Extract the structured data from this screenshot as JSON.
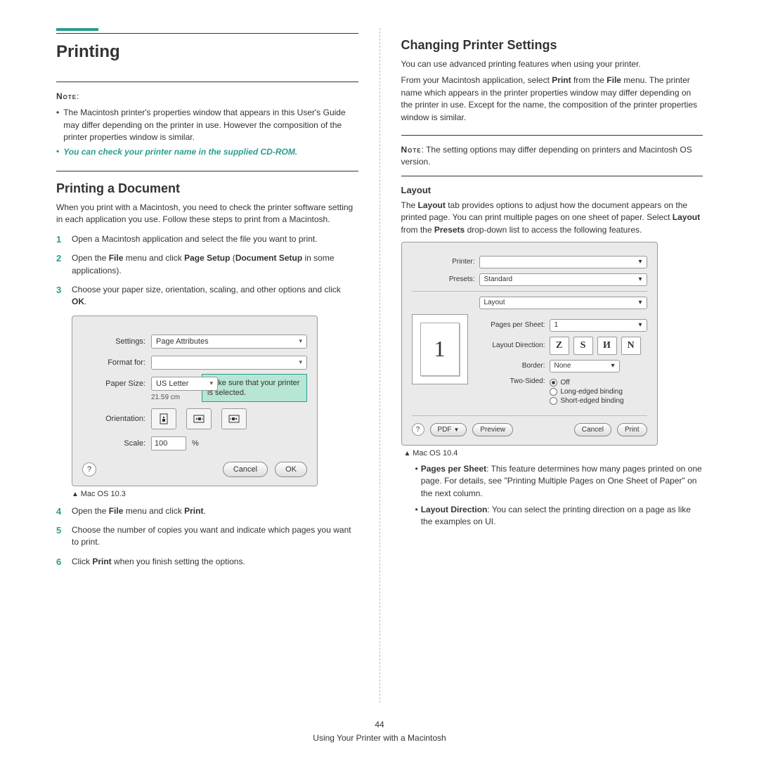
{
  "left": {
    "h1": "Printing",
    "noteLabel": "Note",
    "noteColon": ":",
    "noteBullet1": "The Macintosh printer's properties window that appears in this User's Guide may differ depending on the printer in use. However the composition of the printer properties window is similar.",
    "noteBullet2": "You can check your printer name in the supplied CD-ROM.",
    "h2": "Printing a Document",
    "intro": "When you print with a Macintosh, you need to check the printer software setting in each application you use. Follow these steps to print from a Macintosh.",
    "step1": "Open a Macintosh application and select the file you want to print.",
    "step2a": "Open the ",
    "step2b": "File",
    "step2c": " menu and click ",
    "step2d": "Page Setup",
    "step2e": " (",
    "step2f": "Document Setup",
    "step2g": " in some applications).",
    "step3a": "Choose your paper size, orientation, scaling, and other options and click ",
    "step3b": "OK",
    "step3c": ".",
    "dlg1": {
      "settingsLabel": "Settings:",
      "settingsValue": "Page Attributes",
      "formatLabel": "Format for:",
      "paperLabel": "Paper Size:",
      "paperValue": "US Letter",
      "paperDim": "21.59 cm",
      "orientLabel": "Orientation:",
      "scaleLabel": "Scale:",
      "scaleValue": "100",
      "scalePct": "%",
      "cancel": "Cancel",
      "ok": "OK",
      "help": "?",
      "callout": "Make sure that your printer is selected."
    },
    "caption1": "Mac OS 10.3",
    "step4a": "Open the ",
    "step4b": "File",
    "step4c": " menu and click ",
    "step4d": "Print",
    "step4e": ".",
    "step5": "Choose the number of copies you want and indicate which pages you want to print.",
    "step6a": "Click ",
    "step6b": "Print",
    "step6c": " when you finish setting the options."
  },
  "right": {
    "h2": "Changing Printer Settings",
    "p1": "You can use advanced printing features when using your printer.",
    "p2a": "From your Macintosh application, select ",
    "p2b": "Print",
    "p2c": " from the ",
    "p2d": "File",
    "p2e": " menu. The printer name which appears in the printer properties window may differ depending on the printer in use. Except for the name, the composition of the printer properties window is similar.",
    "noteLabel": "Note",
    "noteText": ": The setting options may differ depending on printers and Macintosh OS version.",
    "h3": "Layout",
    "layoutP_a": "The ",
    "layoutP_b": "Layout",
    "layoutP_c": " tab provides options to adjust how the document appears on the printed page. You can print multiple pages on one sheet of paper. Select ",
    "layoutP_d": "Layout",
    "layoutP_e": " from the ",
    "layoutP_f": "Presets",
    "layoutP_g": " drop-down list to access the following features.",
    "dlg2": {
      "printerLabel": "Printer:",
      "presetsLabel": "Presets:",
      "presetsValue": "Standard",
      "sectionValue": "Layout",
      "ppsLabel": "Pages per Sheet:",
      "ppsValue": "1",
      "ldLabel": "Layout Direction:",
      "borderLabel": "Border:",
      "borderValue": "None",
      "twoSidedLabel": "Two-Sided:",
      "off": "Off",
      "longEdge": "Long-edged binding",
      "shortEdge": "Short-edged binding",
      "pdf": "PDF",
      "preview": "Preview",
      "previewNum": "1",
      "cancel": "Cancel",
      "print": "Print",
      "help": "?",
      "dirZ": "Z",
      "dirS": "S",
      "dirU": "И",
      "dirN": "N"
    },
    "caption2": "Mac OS 10.4",
    "b1a": "Pages per Sheet",
    "b1b": ": This feature determines how many pages printed on one page. For details, see \"Printing Multiple Pages on One Sheet of Paper\" on the next column.",
    "b2a": "Layout Direction",
    "b2b": ": You can select the printing direction on a page as like the examples on UI."
  },
  "footer": {
    "pageNum": "44",
    "title": "Using Your Printer with a Macintosh"
  }
}
